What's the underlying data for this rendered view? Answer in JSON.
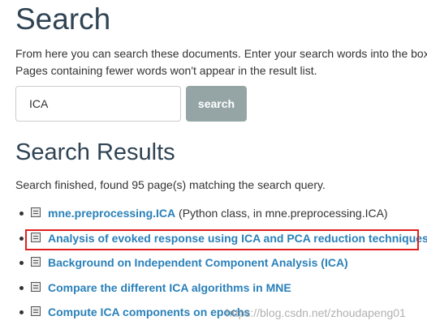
{
  "page": {
    "title": "Search",
    "intro_line1": "From here you can search these documents. Enter your search words into the box",
    "intro_line2": "Pages containing fewer words won't appear in the result list."
  },
  "search": {
    "value": "ICA",
    "placeholder": "",
    "button_label": "search"
  },
  "results_section": {
    "title": "Search Results",
    "status": "Search finished, found 95 page(s) matching the search query."
  },
  "results": [
    {
      "title": "mne.preprocessing.ICA",
      "description": " (Python class, in mne.preprocessing.ICA)"
    },
    {
      "title": "Analysis of evoked response using ICA and PCA reduction techniques",
      "description": ""
    },
    {
      "title": "Background on Independent Component Analysis (ICA)",
      "description": ""
    },
    {
      "title": "Compare the different ICA algorithms in MNE",
      "description": ""
    },
    {
      "title": "Compute ICA components on epochs",
      "description": ""
    }
  ],
  "watermark": "https://blog.csdn.net/zhoudapeng01",
  "colors": {
    "heading": "#2f4353",
    "link": "#2980b9",
    "button_bg": "#95a5a6",
    "highlight": "#e0201e"
  },
  "icons": {
    "result_icon": "document-icon"
  }
}
